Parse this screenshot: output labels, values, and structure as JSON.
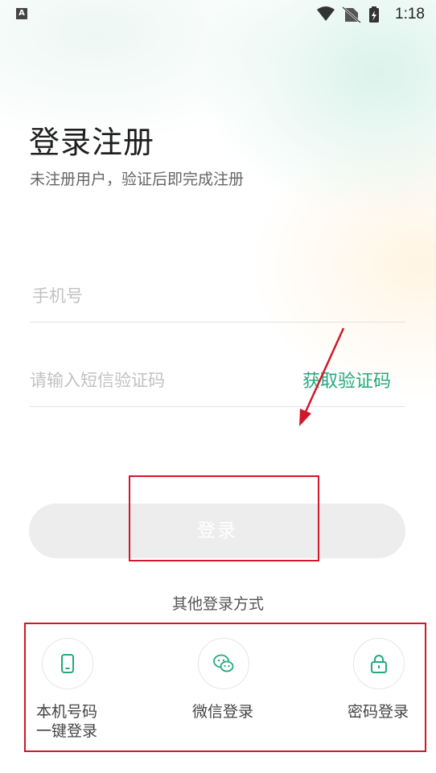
{
  "status_bar": {
    "indicator": "A",
    "time": "1:18",
    "icons": [
      "wifi-icon",
      "no-sim-icon",
      "battery-charging-icon"
    ]
  },
  "page": {
    "title": "登录注册",
    "subtitle": "未注册用户，验证后即完成注册"
  },
  "form": {
    "phone_placeholder": "手机号",
    "phone_value": "",
    "code_placeholder": "请输入短信验证码",
    "code_value": "",
    "get_code_label": "获取验证码",
    "login_label": "登录"
  },
  "other_login": {
    "title": "其他登录方式",
    "options": [
      {
        "label_line1": "本机号码",
        "label_line2": "一键登录",
        "icon": "phone-icon"
      },
      {
        "label_line1": "微信登录",
        "icon": "wechat-icon"
      },
      {
        "label_line1": "密码登录",
        "icon": "lock-icon"
      }
    ]
  },
  "colors": {
    "accent": "#23a97b",
    "annotation_red": "#d0182a",
    "button_disabled": "#ededed"
  }
}
